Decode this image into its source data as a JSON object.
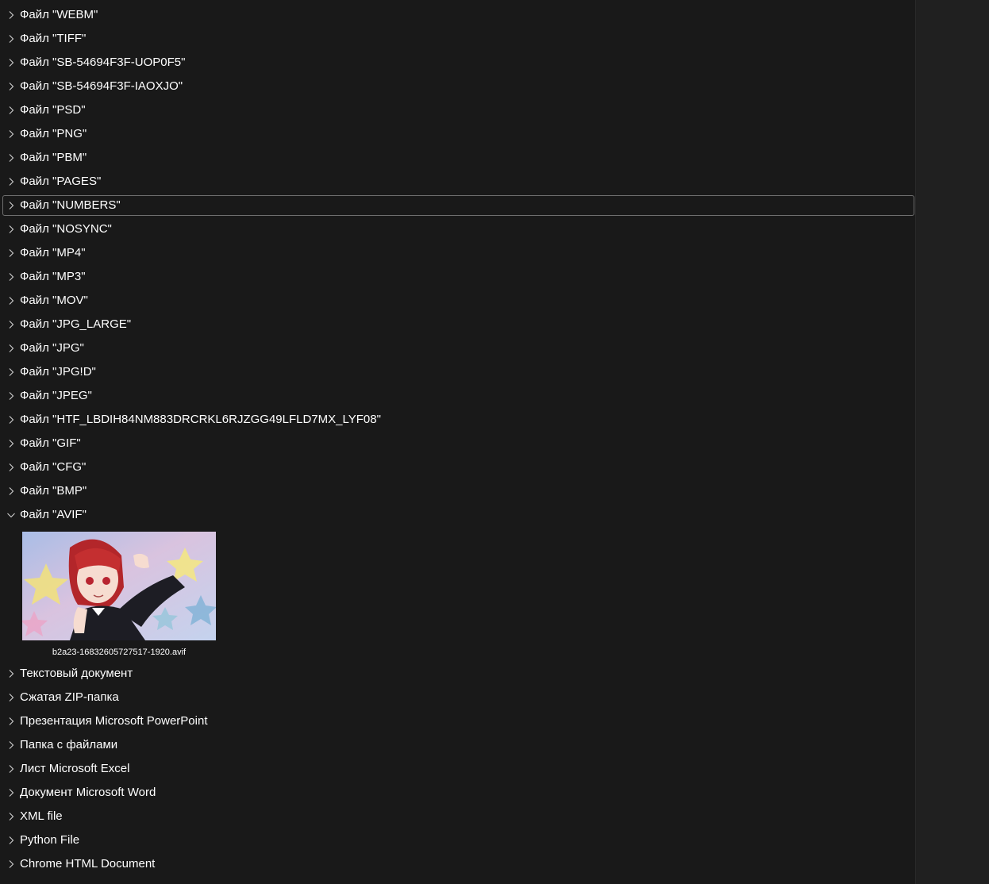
{
  "groups_top": [
    {
      "label": "Файл \"WEBM\""
    },
    {
      "label": "Файл \"TIFF\""
    },
    {
      "label": "Файл \"SB-54694F3F-UOP0F5\""
    },
    {
      "label": "Файл \"SB-54694F3F-IAOXJO\""
    },
    {
      "label": "Файл \"PSD\""
    },
    {
      "label": "Файл \"PNG\""
    },
    {
      "label": "Файл \"PBM\""
    },
    {
      "label": "Файл \"PAGES\""
    },
    {
      "label": "Файл \"NUMBERS\"",
      "focused": true
    },
    {
      "label": "Файл \"NOSYNC\""
    },
    {
      "label": "Файл \"MP4\""
    },
    {
      "label": "Файл \"MP3\""
    },
    {
      "label": "Файл \"MOV\""
    },
    {
      "label": "Файл \"JPG_LARGE\""
    },
    {
      "label": "Файл \"JPG\""
    },
    {
      "label": "Файл \"JPG!D\""
    },
    {
      "label": "Файл \"JPEG\""
    },
    {
      "label": "Файл \"HTF_LBDIH84NM883DRCRKL6RJZGG49LFLD7MX_LYF08\""
    },
    {
      "label": "Файл \"GIF\""
    },
    {
      "label": "Файл \"CFG\""
    },
    {
      "label": "Файл \"BMP\""
    },
    {
      "label": "Файл \"AVIF\"",
      "expanded": true
    }
  ],
  "expanded_group": {
    "files": [
      {
        "name": "b2a23-16832605727517-1920.avif",
        "thumbnail": "anime-girl-red-hair-stars-image"
      }
    ]
  },
  "groups_bottom": [
    {
      "label": "Текстовый документ"
    },
    {
      "label": "Сжатая ZIP-папка"
    },
    {
      "label": "Презентация Microsoft PowerPoint"
    },
    {
      "label": "Папка с файлами"
    },
    {
      "label": "Лист Microsoft Excel"
    },
    {
      "label": "Документ Microsoft Word"
    },
    {
      "label": "XML file"
    },
    {
      "label": "Python File"
    },
    {
      "label": "Chrome HTML Document"
    }
  ],
  "colors": {
    "background": "#191919",
    "side_pane": "#202020",
    "focus_border": "#6f6f6f",
    "text": "#ffffff"
  }
}
